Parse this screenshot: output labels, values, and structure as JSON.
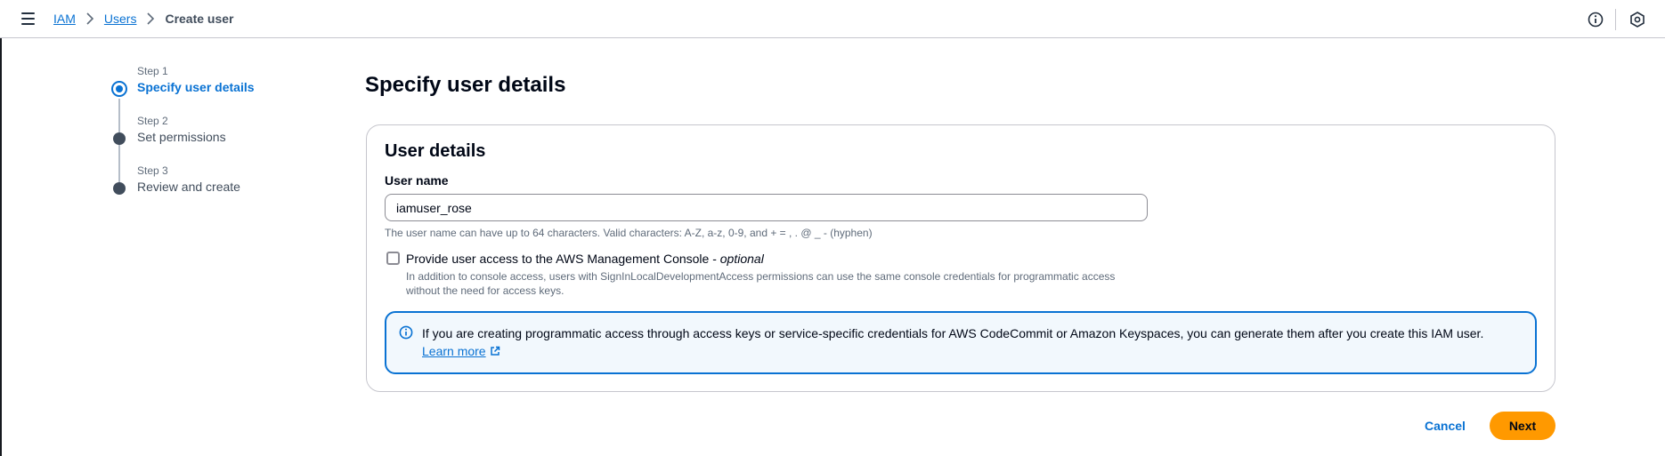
{
  "breadcrumb": {
    "items": [
      "IAM",
      "Users"
    ],
    "current": "Create user"
  },
  "icons": {
    "menu": "hamburger-menu-icon",
    "info": "info-circle-icon",
    "settings": "settings-hexagon-icon",
    "chevron": "chevron-right-icon",
    "external": "external-link-icon"
  },
  "wizard": {
    "steps": [
      {
        "label": "Step 1",
        "title": "Specify user details",
        "state": "active"
      },
      {
        "label": "Step 2",
        "title": "Set permissions",
        "state": "inactive"
      },
      {
        "label": "Step 3",
        "title": "Review and create",
        "state": "inactive"
      }
    ]
  },
  "page": {
    "title": "Specify user details"
  },
  "user_details": {
    "title": "User details",
    "username_label": "User name",
    "username_value": "iamuser_rose",
    "username_hint": "The user name can have up to 64 characters. Valid characters: A-Z, a-z, 0-9, and + = , . @ _ - (hyphen)",
    "console_access_label": "Provide user access to the AWS Management Console - ",
    "console_access_optional": "optional",
    "console_access_checked": false,
    "console_access_desc": "In addition to console access, users with SignInLocalDevelopmentAccess permissions can use the same console credentials for programmatic access without the need for access keys."
  },
  "alert": {
    "text": "If you are creating programmatic access through access keys or service-specific credentials for AWS CodeCommit or Amazon Keyspaces, you can generate them after you create this IAM user.",
    "link": "Learn more"
  },
  "actions": {
    "cancel": "Cancel",
    "next": "Next"
  },
  "colors": {
    "link": "#0972d3",
    "primary_button": "#ff9900",
    "alert_bg": "#f2f8fd"
  }
}
